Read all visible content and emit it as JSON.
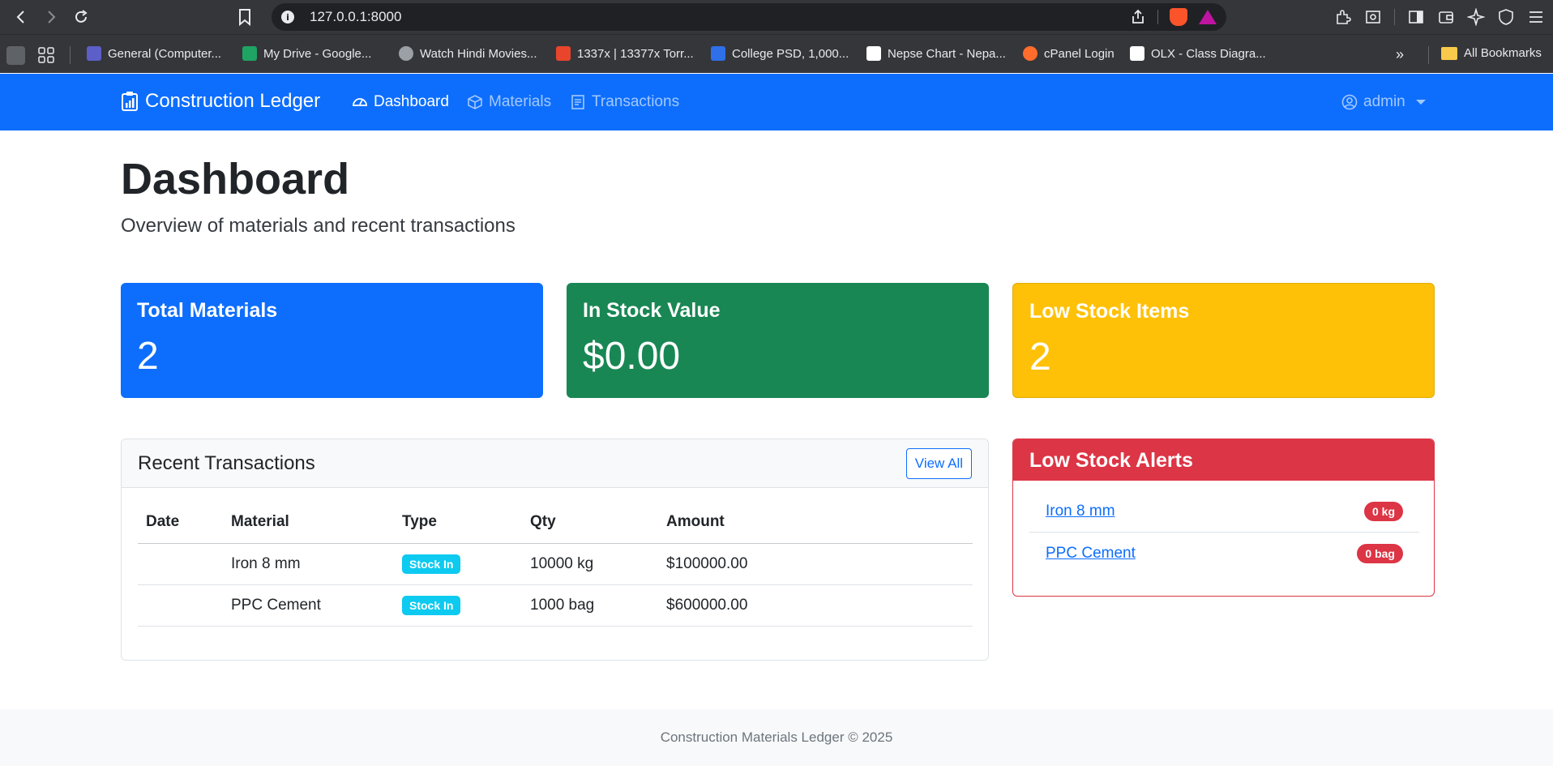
{
  "browser": {
    "url": "127.0.0.1:8000",
    "bookmarks": [
      {
        "label": "General (Computer...",
        "color": "#5b5fc7"
      },
      {
        "label": "My Drive - Google...",
        "color": "#1fa463"
      },
      {
        "label": "Watch Hindi Movies...",
        "color": "#9aa0a6"
      },
      {
        "label": "1337x | 13377x Torr...",
        "color": "#e8452c"
      },
      {
        "label": "College PSD, 1,000...",
        "color": "#2f6fea"
      },
      {
        "label": "Nepse Chart - Nepa...",
        "color": "#ffffff"
      },
      {
        "label": "cPanel Login",
        "color": "#ff6c2c"
      },
      {
        "label": "OLX - Class Diagra...",
        "color": "#ffffff"
      }
    ],
    "all_bookmarks": "All Bookmarks"
  },
  "navbar": {
    "brand": "Construction Ledger",
    "links": [
      {
        "label": "Dashboard"
      },
      {
        "label": "Materials"
      },
      {
        "label": "Transactions"
      }
    ],
    "user": "admin"
  },
  "page": {
    "title": "Dashboard",
    "lead": "Overview of materials and recent transactions"
  },
  "stats": [
    {
      "label": "Total Materials",
      "value": "2",
      "color": "#0d6efd"
    },
    {
      "label": "In Stock Value",
      "value": "$0.00",
      "color": "#198754"
    },
    {
      "label": "Low Stock Items",
      "value": "2",
      "color": "#ffc107"
    }
  ],
  "transactions": {
    "title": "Recent Transactions",
    "view_all": "View All",
    "columns": [
      "Date",
      "Material",
      "Type",
      "Qty",
      "Amount"
    ],
    "rows": [
      {
        "date": "",
        "material": "Iron 8 mm",
        "type": "Stock In",
        "qty": "10000 kg",
        "amount": "$100000.00"
      },
      {
        "date": "",
        "material": "PPC Cement",
        "type": "Stock In",
        "qty": "1000 bag",
        "amount": "$600000.00"
      }
    ]
  },
  "alerts": {
    "title": "Low Stock Alerts",
    "items": [
      {
        "name": "Iron 8 mm",
        "qty": "0 kg"
      },
      {
        "name": "PPC Cement",
        "qty": "0 bag"
      }
    ]
  },
  "footer": {
    "text": "Construction Materials Ledger © 2025"
  }
}
